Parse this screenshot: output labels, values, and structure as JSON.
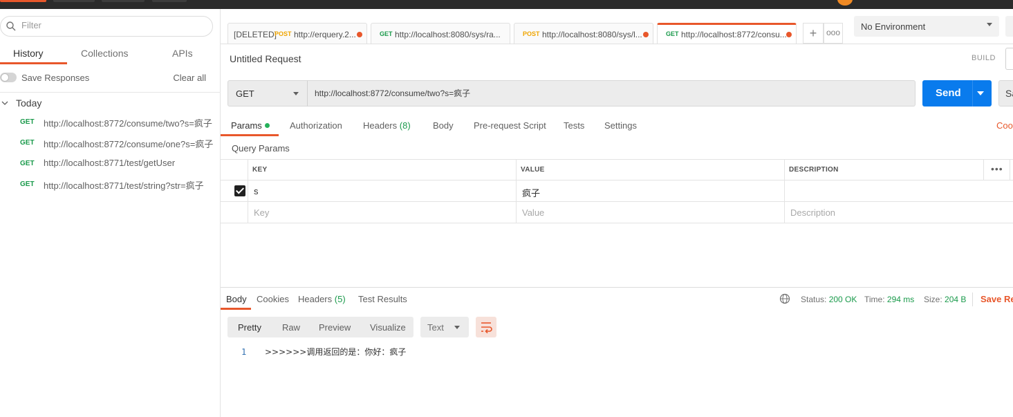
{
  "sidebar": {
    "filter_placeholder": "Filter",
    "tabs": [
      "History",
      "Collections",
      "APIs"
    ],
    "save_responses_label": "Save Responses",
    "clear_all_label": "Clear all",
    "group_label": "Today",
    "history": [
      {
        "method": "GET",
        "url": "http://localhost:8772/consume/two?s=疯子"
      },
      {
        "method": "GET",
        "url": "http://localhost:8772/consume/one?s=疯子"
      },
      {
        "method": "GET",
        "url": "http://localhost:8771/test/getUser"
      },
      {
        "method": "GET",
        "url": "http://localhost:8771/test/string?str=疯子"
      }
    ]
  },
  "request_tabs": [
    {
      "prefix": "[DELETED]",
      "method": "POST",
      "url": "http://erquery.2..."
    },
    {
      "prefix": "",
      "method": "GET",
      "url": "http://localhost:8080/sys/ra..."
    },
    {
      "prefix": "",
      "method": "POST",
      "url": "http://localhost:8080/sys/l..."
    },
    {
      "prefix": "",
      "method": "GET",
      "url": "http://localhost:8772/consu..."
    }
  ],
  "environment": "No Environment",
  "request": {
    "title": "Untitled Request",
    "build_label": "BUILD",
    "method": "GET",
    "url": "http://localhost:8772/consume/two?s=疯子",
    "send_label": "Send",
    "save_label": "Save"
  },
  "request_subtabs": {
    "params": "Params",
    "authorization": "Authorization",
    "headers": "Headers",
    "headers_count": "(8)",
    "body": "Body",
    "prerequest": "Pre-request Script",
    "tests": "Tests",
    "settings": "Settings",
    "cookies": "Cookies"
  },
  "query_params": {
    "label": "Query Params",
    "columns": [
      "KEY",
      "VALUE",
      "DESCRIPTION"
    ],
    "rows": [
      {
        "checked": true,
        "key": "s",
        "value": "疯子",
        "description": ""
      }
    ],
    "placeholders": {
      "key": "Key",
      "value": "Value",
      "description": "Description"
    }
  },
  "response": {
    "tabs": {
      "body": "Body",
      "cookies": "Cookies",
      "headers": "Headers",
      "headers_count": "(5)",
      "tests": "Test Results"
    },
    "status_label": "Status:",
    "status_value": "200 OK",
    "time_label": "Time:",
    "time_value": "294 ms",
    "size_label": "Size:",
    "size_value": "204 B",
    "save_label": "Save Response",
    "formats": [
      "Pretty",
      "Raw",
      "Preview",
      "Visualize"
    ],
    "type": "Text",
    "lines": [
      {
        "num": "1",
        "text": ">>>>>>调用返回的是：你好：疯子"
      }
    ]
  },
  "colors": {
    "accent": "#e8572b",
    "send": "#097bed",
    "get": "#1a9a4b",
    "post": "#f0a500"
  }
}
